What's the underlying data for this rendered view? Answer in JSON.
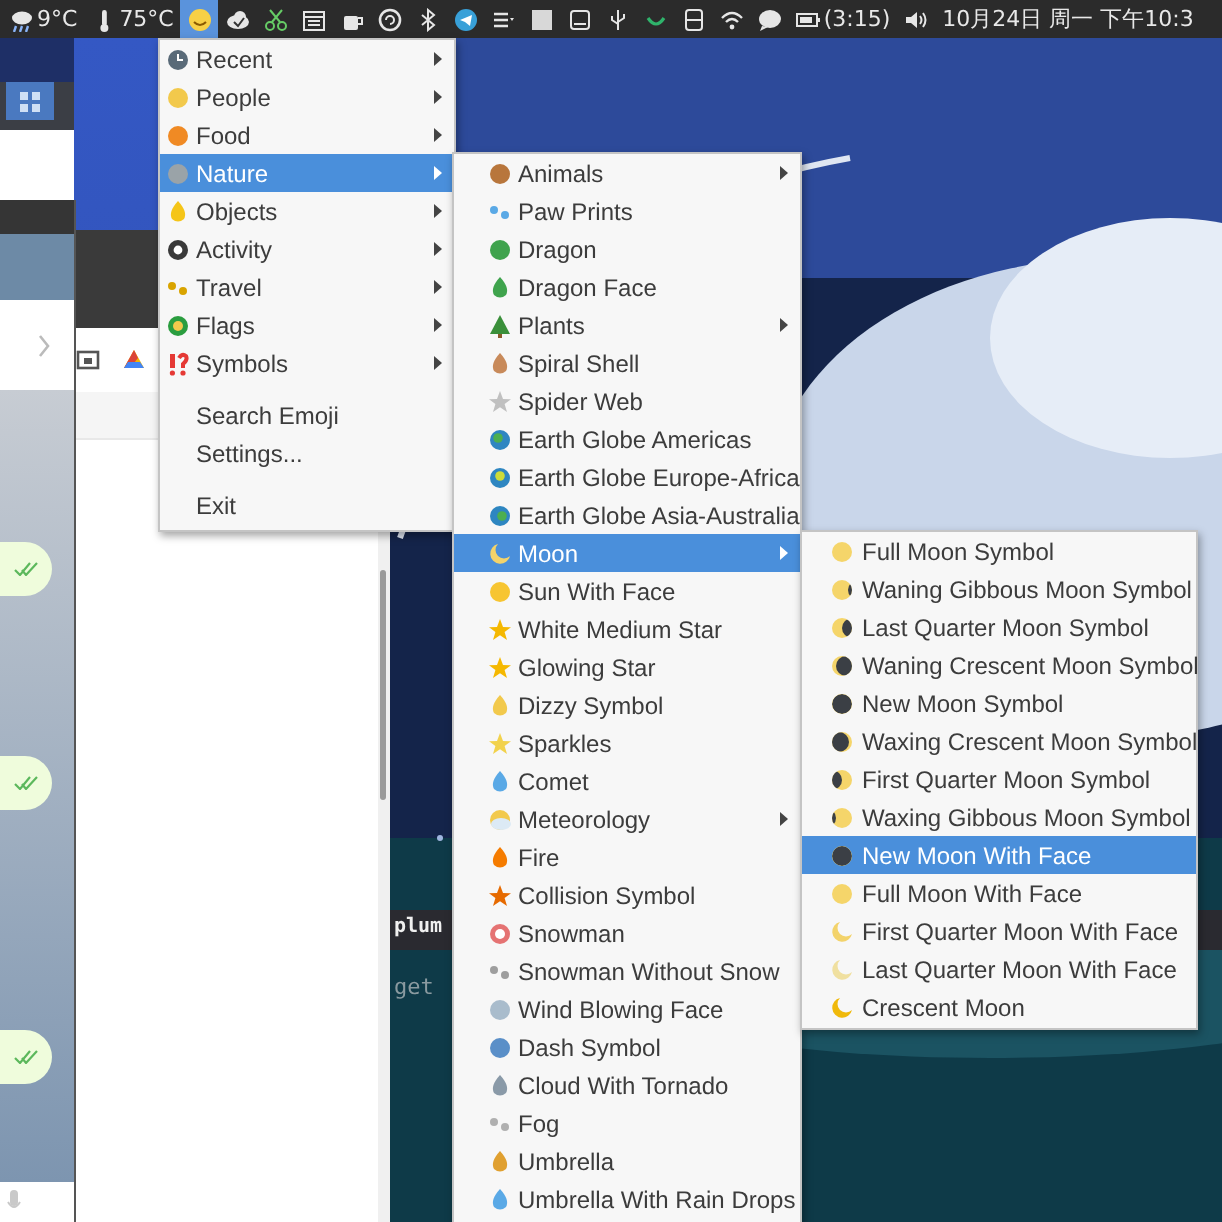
{
  "top_bar": {
    "indicators": [
      {
        "kind": "weather",
        "text": "9°C",
        "selected": false
      },
      {
        "kind": "thermometer",
        "text": "75°C",
        "selected": false
      },
      {
        "kind": "emoji",
        "selected": true
      },
      {
        "kind": "cloud",
        "selected": false
      },
      {
        "kind": "scissors",
        "selected": false
      },
      {
        "kind": "calendar",
        "selected": false
      },
      {
        "kind": "cup",
        "selected": false
      },
      {
        "kind": "sync",
        "selected": false
      },
      {
        "kind": "bluetooth",
        "selected": false
      },
      {
        "kind": "telegram",
        "selected": false
      },
      {
        "kind": "list",
        "selected": false
      },
      {
        "kind": "square",
        "selected": false
      },
      {
        "kind": "monitor",
        "selected": false
      },
      {
        "kind": "usb",
        "selected": false
      },
      {
        "kind": "arc",
        "selected": false
      },
      {
        "kind": "phone",
        "selected": false
      },
      {
        "kind": "wifi",
        "selected": false
      },
      {
        "kind": "chat",
        "selected": false
      },
      {
        "kind": "battery",
        "text": "(3:15)",
        "selected": false
      },
      {
        "kind": "volume",
        "selected": false
      },
      {
        "kind": "clock",
        "text": "10月24日 周一 下午10:3",
        "selected": false
      }
    ]
  },
  "chat_window": {
    "messages": [
      {
        "read": true
      },
      {
        "read": true
      },
      {
        "read": true
      }
    ]
  },
  "terminal": {
    "lines": [
      "plum",
      "get"
    ]
  },
  "emoji_menu": {
    "items": [
      {
        "kind": "category",
        "label": "Recent",
        "submenu": true,
        "selected": false
      },
      {
        "kind": "category",
        "label": "People",
        "submenu": true,
        "selected": false
      },
      {
        "kind": "category",
        "label": "Food",
        "submenu": true,
        "selected": false
      },
      {
        "kind": "category",
        "label": "Nature",
        "submenu": true,
        "selected": true
      },
      {
        "kind": "category",
        "label": "Objects",
        "submenu": true,
        "selected": false
      },
      {
        "kind": "category",
        "label": "Activity",
        "submenu": true,
        "selected": false
      },
      {
        "kind": "category",
        "label": "Travel",
        "submenu": true,
        "selected": false
      },
      {
        "kind": "category",
        "label": "Flags",
        "submenu": true,
        "selected": false
      },
      {
        "kind": "category",
        "label": "Symbols",
        "submenu": true,
        "selected": false
      },
      {
        "kind": "separator"
      },
      {
        "kind": "action",
        "label": "Search Emoji",
        "submenu": false,
        "selected": false
      },
      {
        "kind": "action",
        "label": "Settings...",
        "submenu": false,
        "selected": false
      },
      {
        "kind": "separator"
      },
      {
        "kind": "action",
        "label": "Exit",
        "submenu": false,
        "selected": false
      }
    ]
  },
  "nature_menu": {
    "items": [
      {
        "kind": "category",
        "label": "Animals",
        "submenu": true,
        "selected": false
      },
      {
        "kind": "category",
        "label": "Paw Prints",
        "submenu": false,
        "selected": false
      },
      {
        "kind": "category",
        "label": "Dragon",
        "submenu": false,
        "selected": false
      },
      {
        "kind": "category",
        "label": "Dragon Face",
        "submenu": false,
        "selected": false
      },
      {
        "kind": "category",
        "label": "Plants",
        "submenu": true,
        "selected": false
      },
      {
        "kind": "category",
        "label": "Spiral Shell",
        "submenu": false,
        "selected": false
      },
      {
        "kind": "category",
        "label": "Spider Web",
        "submenu": false,
        "selected": false
      },
      {
        "kind": "category",
        "label": "Earth Globe Americas",
        "submenu": false,
        "selected": false
      },
      {
        "kind": "category",
        "label": "Earth Globe Europe-Africa",
        "submenu": false,
        "selected": false
      },
      {
        "kind": "category",
        "label": "Earth Globe Asia-Australia",
        "submenu": false,
        "selected": false
      },
      {
        "kind": "category",
        "label": "Moon",
        "submenu": true,
        "selected": true
      },
      {
        "kind": "category",
        "label": "Sun With Face",
        "submenu": false,
        "selected": false
      },
      {
        "kind": "category",
        "label": "White Medium Star",
        "submenu": false,
        "selected": false
      },
      {
        "kind": "category",
        "label": "Glowing Star",
        "submenu": false,
        "selected": false
      },
      {
        "kind": "category",
        "label": "Dizzy Symbol",
        "submenu": false,
        "selected": false
      },
      {
        "kind": "category",
        "label": "Sparkles",
        "submenu": false,
        "selected": false
      },
      {
        "kind": "category",
        "label": "Comet",
        "submenu": false,
        "selected": false
      },
      {
        "kind": "category",
        "label": "Meteorology",
        "submenu": true,
        "selected": false
      },
      {
        "kind": "category",
        "label": "Fire",
        "submenu": false,
        "selected": false
      },
      {
        "kind": "category",
        "label": "Collision Symbol",
        "submenu": false,
        "selected": false
      },
      {
        "kind": "category",
        "label": "Snowman",
        "submenu": false,
        "selected": false
      },
      {
        "kind": "category",
        "label": "Snowman Without Snow",
        "submenu": false,
        "selected": false
      },
      {
        "kind": "category",
        "label": "Wind Blowing Face",
        "submenu": false,
        "selected": false
      },
      {
        "kind": "category",
        "label": "Dash Symbol",
        "submenu": false,
        "selected": false
      },
      {
        "kind": "category",
        "label": "Cloud With Tornado",
        "submenu": false,
        "selected": false
      },
      {
        "kind": "category",
        "label": "Fog",
        "submenu": false,
        "selected": false
      },
      {
        "kind": "category",
        "label": "Umbrella",
        "submenu": false,
        "selected": false
      },
      {
        "kind": "category",
        "label": "Umbrella With Rain Drops",
        "submenu": false,
        "selected": false
      }
    ]
  },
  "moon_menu": {
    "items": [
      {
        "kind": "category",
        "label": "Full Moon Symbol",
        "submenu": false,
        "selected": false
      },
      {
        "kind": "category",
        "label": "Waning Gibbous Moon Symbol",
        "submenu": false,
        "selected": false
      },
      {
        "kind": "category",
        "label": "Last Quarter Moon Symbol",
        "submenu": false,
        "selected": false
      },
      {
        "kind": "category",
        "label": "Waning Crescent Moon Symbol",
        "submenu": false,
        "selected": false
      },
      {
        "kind": "category",
        "label": "New Moon Symbol",
        "submenu": false,
        "selected": false
      },
      {
        "kind": "category",
        "label": "Waxing Crescent Moon Symbol",
        "submenu": false,
        "selected": false
      },
      {
        "kind": "category",
        "label": "First Quarter Moon Symbol",
        "submenu": false,
        "selected": false
      },
      {
        "kind": "category",
        "label": "Waxing Gibbous Moon Symbol",
        "submenu": false,
        "selected": false
      },
      {
        "kind": "category",
        "label": "New Moon With Face",
        "submenu": false,
        "selected": true
      },
      {
        "kind": "category",
        "label": "Full Moon With Face",
        "submenu": false,
        "selected": false
      },
      {
        "kind": "category",
        "label": "First Quarter Moon With Face",
        "submenu": false,
        "selected": false
      },
      {
        "kind": "category",
        "label": "Last Quarter Moon With Face",
        "submenu": false,
        "selected": false
      },
      {
        "kind": "category",
        "label": "Crescent Moon",
        "submenu": false,
        "selected": false
      }
    ]
  }
}
